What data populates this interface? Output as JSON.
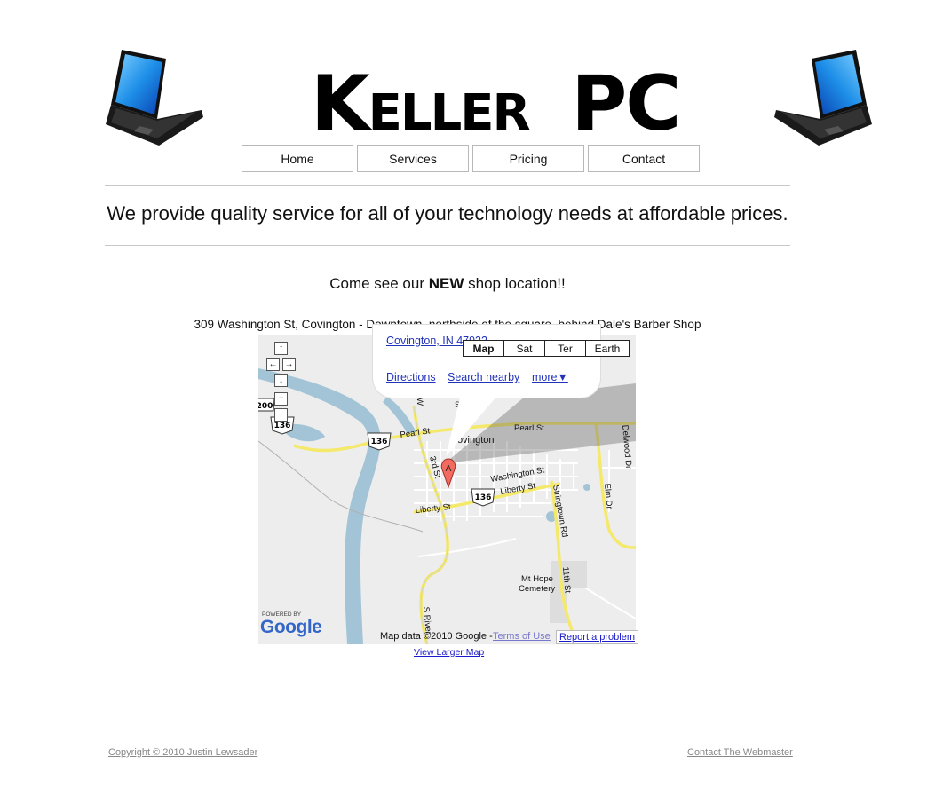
{
  "header": {
    "logo_first_cap": "K",
    "logo_first_rest": "ELLER",
    "logo_second": "PC"
  },
  "nav": {
    "items": [
      "Home",
      "Services",
      "Pricing",
      "Contact"
    ]
  },
  "tagline": "We provide quality service for all of your technology needs at affordable prices.",
  "promo": {
    "pre": "Come see our ",
    "bold": "NEW",
    "post": " shop location!!"
  },
  "address": "309 Washington St, Covington - Downtown, northside of the square, behind Dale's Barber Shop",
  "map": {
    "type_buttons": [
      "Map",
      "Sat",
      "Ter",
      "Earth"
    ],
    "selected_type": "Map",
    "bubble": {
      "address_link": "Covington, IN 47932",
      "directions": "Directions",
      "search_nearby": "Search nearby",
      "more": "more▼"
    },
    "labels": {
      "school": "School",
      "covington": "Covington",
      "pearl_st_1": "Pearl St",
      "pearl_st_2": "Pearl St",
      "third_st": "3rd St",
      "washington_st": "Washington St",
      "liberty_st_1": "Liberty St",
      "liberty_st_2": "Liberty St",
      "stringtown_rd": "Stringtown Rd",
      "elm_dr": "Elm Dr",
      "delwood_dr": "Delwood Dr",
      "mt_hope": "Mt Hope",
      "cemetery": "Cemetery",
      "eleventh_st": "11th St",
      "s_river": "S River",
      "route_136": "136",
      "route_200": "200",
      "marker": "A",
      "w_label": "W"
    },
    "powered_by": "POWERED BY",
    "google": "Google",
    "map_data": "Map data ©2010 Google -",
    "terms": "Terms of Use",
    "report": "Report a problem"
  },
  "view_larger_map": "View Larger Map",
  "footer": {
    "copyright": "Copyright © 2010 Justin Lewsader",
    "contact": "Contact The Webmaster"
  }
}
